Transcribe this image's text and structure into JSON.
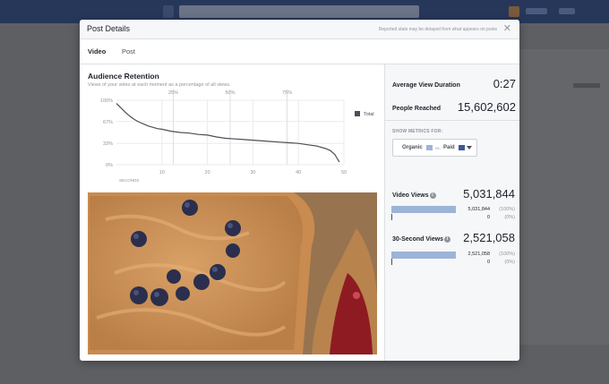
{
  "modal": {
    "title": "Post Details",
    "note": "Reported stats may be delayed from what appears on posts"
  },
  "tabs": [
    {
      "label": "Video",
      "active": true
    },
    {
      "label": "Post",
      "active": false
    }
  ],
  "retention": {
    "title": "Audience Retention",
    "subtitle": "Views of your video at each moment as a percentage of all views."
  },
  "chart_data": {
    "type": "line",
    "title": "",
    "xlabel": "SECONDS",
    "ylabel": "",
    "xlim": [
      0,
      50
    ],
    "ylim": [
      0,
      100
    ],
    "x_ticks": [
      "10",
      "20",
      "30",
      "40",
      "50"
    ],
    "y_ticks": [
      "100%",
      "67%",
      "33%",
      "0%"
    ],
    "quartile_markers": [
      {
        "label": "25%",
        "x": 12.5
      },
      {
        "label": "50%",
        "x": 25
      },
      {
        "label": "75%",
        "x": 37.5
      }
    ],
    "legend": "top-right",
    "grid": true,
    "series": [
      {
        "name": "Total",
        "color": "#4b4f56",
        "x": [
          0,
          1,
          2,
          3,
          4,
          5,
          6,
          7,
          8,
          9,
          10,
          12,
          14,
          16,
          18,
          20,
          22,
          24,
          26,
          28,
          30,
          32,
          34,
          36,
          38,
          40,
          42,
          44,
          46,
          47,
          48,
          49
        ],
        "y": [
          95,
          88,
          81,
          75,
          70,
          66,
          63,
          60,
          58,
          56,
          55,
          52,
          50,
          49,
          47,
          46,
          43,
          41,
          40,
          39,
          38,
          37,
          36,
          35,
          34,
          33,
          31,
          29,
          25,
          22,
          16,
          4
        ]
      }
    ]
  },
  "stats": {
    "avg_view_label": "Average View Duration",
    "avg_view_value": "0:27",
    "reached_label": "People Reached",
    "reached_value": "15,602,602"
  },
  "filter": {
    "label": "SHOW METRICS FOR:",
    "organic": "Organic",
    "vs": "vs.",
    "paid": "Paid",
    "organic_color": "#9cb4d8",
    "paid_color": "#3b5998"
  },
  "metrics": [
    {
      "label": "Video Views",
      "value": "5,031,844",
      "organic_num": "5,031,844",
      "organic_pct": "(100%)",
      "organic_fraction": 1.0,
      "paid_num": "0",
      "paid_pct": "(0%)"
    },
    {
      "label": "30-Second Views",
      "value": "2,521,058",
      "organic_num": "2,521,058",
      "organic_pct": "(100%)",
      "organic_fraction": 1.0,
      "paid_num": "0",
      "paid_pct": "(0%)"
    }
  ]
}
